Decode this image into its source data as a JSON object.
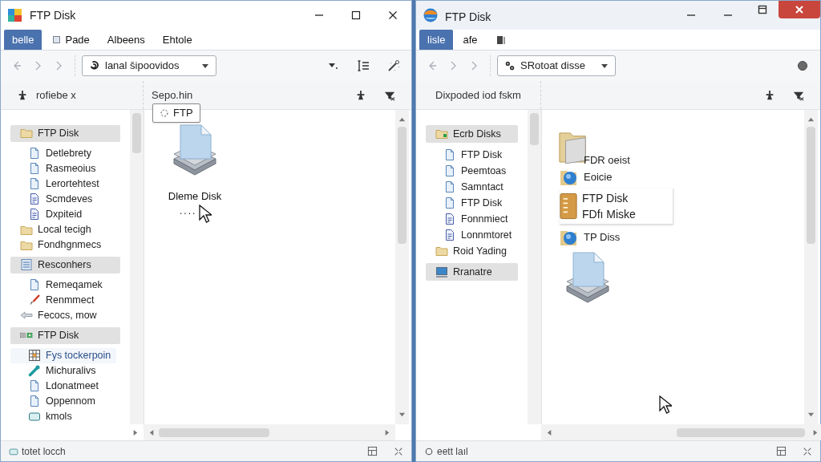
{
  "windows": [
    {
      "title": "FTP Disk",
      "app_icon": {
        "kind": "tiles"
      },
      "cursor": true,
      "controls": [
        {
          "kind": "minimize"
        },
        {
          "kind": "maximize"
        },
        {
          "kind": "close"
        }
      ],
      "tabs": [
        {
          "kind": "text",
          "label": "belle",
          "selected": true
        },
        {
          "kind": "icon_text",
          "label": "Pade",
          "selected": false
        },
        {
          "kind": "text",
          "label": "Albeens",
          "selected": false
        },
        {
          "kind": "text",
          "label": "Ehtole",
          "selected": false
        }
      ],
      "address": {
        "kind": "swirl",
        "value": "lanal šipoovidos"
      },
      "tools": [
        {
          "kind": "caret"
        },
        {
          "kind": "list"
        },
        {
          "kind": "magic"
        }
      ],
      "sidebar_header": {
        "kind": "pin",
        "label": "rofiebe x"
      },
      "content_header": "Sepo.hin",
      "sidebar": [
        {
          "kind": "folder",
          "label": "FTP Disk",
          "selected": true,
          "hovered": false,
          "children": [
            {
              "kind": "doc",
              "label": "Detlebrety",
              "selected": false,
              "hovered": false
            },
            {
              "kind": "doc",
              "label": "Rasmeoius",
              "selected": false,
              "hovered": false
            },
            {
              "kind": "doc",
              "label": "Lerortehtest",
              "selected": false,
              "hovered": false
            },
            {
              "kind": "note",
              "label": "Scmdeves",
              "selected": false,
              "hovered": false
            },
            {
              "kind": "note",
              "label": "Dxpiteid",
              "selected": false,
              "hovered": false
            }
          ]
        },
        {
          "kind": "folder",
          "label": "Local tecigh",
          "selected": false,
          "hovered": false
        },
        {
          "kind": "folder",
          "label": "Fondhgnmecs",
          "selected": false,
          "hovered": false
        },
        {
          "kind": "list",
          "label": "Resconhers",
          "selected": true,
          "hovered": false,
          "children": [
            {
              "kind": "doc",
              "label": "Remeqamek",
              "selected": false,
              "hovered": false
            },
            {
              "kind": "brush",
              "label": "Renmmect",
              "selected": false,
              "hovered": false
            }
          ]
        },
        {
          "kind": "arrow",
          "label": "Fecocs, mow",
          "selected": false,
          "hovered": false
        },
        {
          "kind": "app",
          "label": "FTP Disk",
          "selected": true,
          "hovered": false,
          "children": [
            {
              "kind": "grid",
              "label": "Fys tockerpoin",
              "selected": false,
              "hovered": true
            },
            {
              "kind": "wrench",
              "label": "Michuralivs",
              "selected": false,
              "hovered": false
            },
            {
              "kind": "doc",
              "label": "Ldonatmeet",
              "selected": false,
              "hovered": false
            },
            {
              "kind": "doc",
              "label": "Oppennom",
              "selected": false,
              "hovered": false
            },
            {
              "kind": "drive",
              "label": "kmols",
              "selected": false,
              "hovered": false
            }
          ]
        }
      ],
      "content": [
        {
          "kind": "tooltip",
          "label": "FTP"
        },
        {
          "kind": "disk",
          "label": "Dleme Disk"
        },
        {
          "kind": "dots",
          "label": "...."
        }
      ],
      "status": {
        "kind": "drive",
        "text": "totet locch"
      }
    },
    {
      "title": "FTP Disk",
      "app_icon": {
        "kind": "globe"
      },
      "cursor": true,
      "controls": [
        {
          "kind": "minimize"
        },
        {
          "kind": "minimize"
        },
        {
          "kind": "restore"
        },
        {
          "kind": "close_red"
        }
      ],
      "tabs": [
        {
          "kind": "text",
          "label": "lisle",
          "selected": true
        },
        {
          "kind": "text",
          "label": "afe",
          "selected": false
        },
        {
          "kind": "icon",
          "selected": false
        }
      ],
      "address": {
        "kind": "gears",
        "value": "SRotoat disse"
      },
      "tools": [
        {
          "kind": "dot"
        }
      ],
      "sidebar_header": {
        "kind": "none",
        "label": "Dixpoded iod fskm"
      },
      "sidebar": [
        {
          "kind": "folder_green",
          "label": "Ecrb Disks",
          "selected": true,
          "hovered": false,
          "children": [
            {
              "kind": "doc",
              "label": "FTP Disk",
              "selected": false,
              "hovered": false
            },
            {
              "kind": "doc",
              "label": "Peemtoas",
              "selected": false,
              "hovered": false
            },
            {
              "kind": "doc",
              "label": "Samntact",
              "selected": false,
              "hovered": false
            },
            {
              "kind": "doc",
              "label": "FTP Disk",
              "selected": false,
              "hovered": false
            },
            {
              "kind": "note",
              "label": "Fonnmiect",
              "selected": false,
              "hovered": false
            },
            {
              "kind": "note",
              "label": "Lonnmtoret",
              "selected": false,
              "hovered": false
            }
          ]
        },
        {
          "kind": "folder",
          "label": "Roid Yading",
          "selected": false,
          "hovered": false
        },
        {
          "kind": "monitor",
          "label": "Rranatre",
          "selected": true,
          "hovered": false
        }
      ],
      "content": [
        {
          "kind": "bigfolder",
          "label": "FDR oeist"
        },
        {
          "kind": "globe",
          "label": "Eoicie"
        },
        {
          "kind": "group",
          "labels": [
            "FTP Disk",
            "FDfı Miske"
          ]
        },
        {
          "kind": "globe",
          "label": "TP Diss"
        },
        {
          "kind": "disk"
        }
      ],
      "status": {
        "kind": "circle",
        "text": "eett laıl"
      }
    }
  ]
}
